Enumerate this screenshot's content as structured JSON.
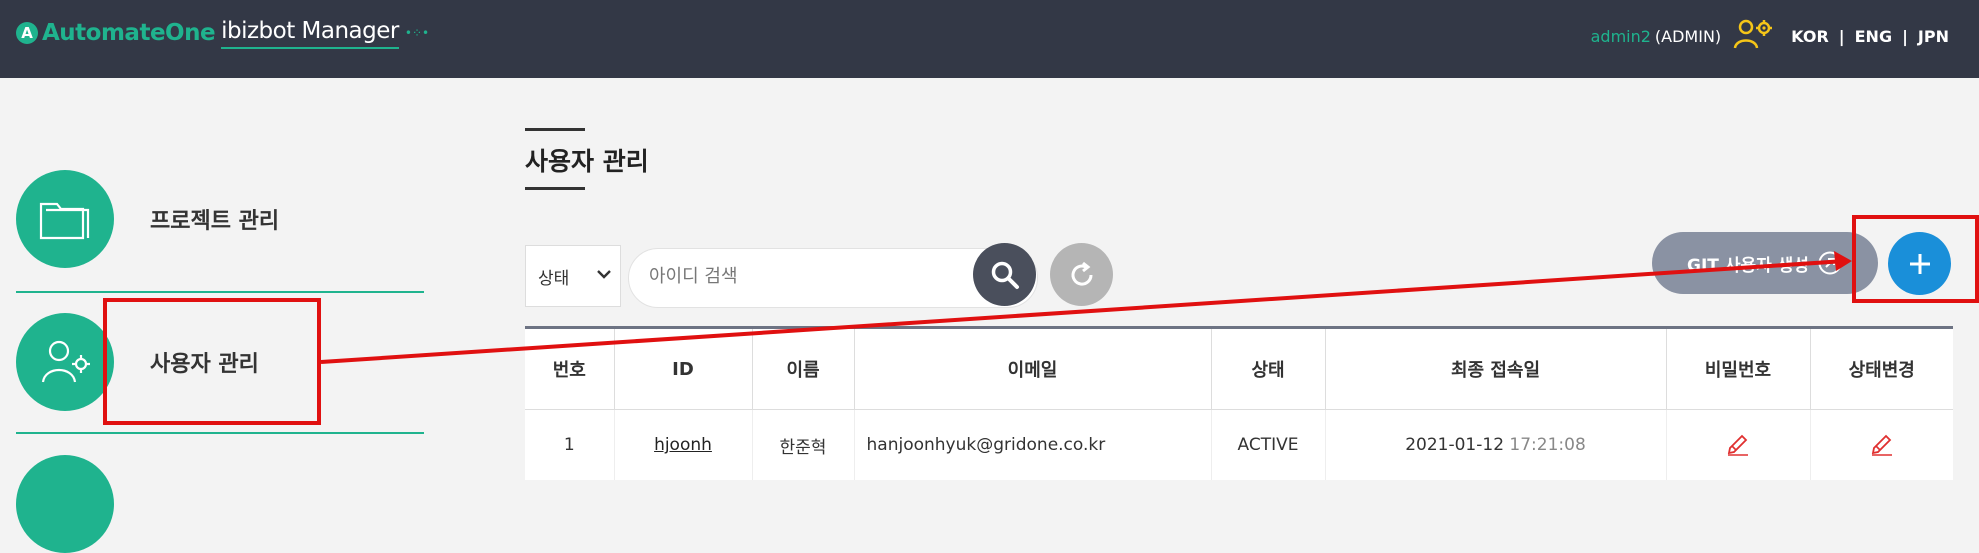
{
  "header": {
    "logo_brand": "AutomateOne",
    "product": "ibizbot Manager",
    "username": "admin2",
    "role": "(ADMIN)",
    "languages": [
      "KOR",
      "ENG",
      "JPN"
    ],
    "separator": "|"
  },
  "sidebar": {
    "items": [
      {
        "label": "프로젝트 관리",
        "icon": "folder-icon"
      },
      {
        "label": "사용자 관리",
        "icon": "user-settings-icon"
      }
    ]
  },
  "page": {
    "title": "사용자 관리"
  },
  "filters": {
    "status_label": "상태",
    "search_placeholder": "아이디 검색",
    "git_button": "GIT 사용자 생성"
  },
  "table": {
    "headers": [
      "번호",
      "ID",
      "이름",
      "이메일",
      "상태",
      "최종 접속일",
      "비밀번호",
      "상태변경"
    ],
    "rows": [
      {
        "no": "1",
        "id": "hjoonh",
        "name": "한준혁",
        "email": "hanjoonhyuk@gridone.co.kr",
        "status": "ACTIVE",
        "date": "2021-01-12",
        "time": "17:21:08"
      }
    ]
  },
  "colors": {
    "accent": "#1fb38e",
    "header_bg": "#333846",
    "add_button": "#1a8fd9",
    "annotation": "#e01010"
  }
}
